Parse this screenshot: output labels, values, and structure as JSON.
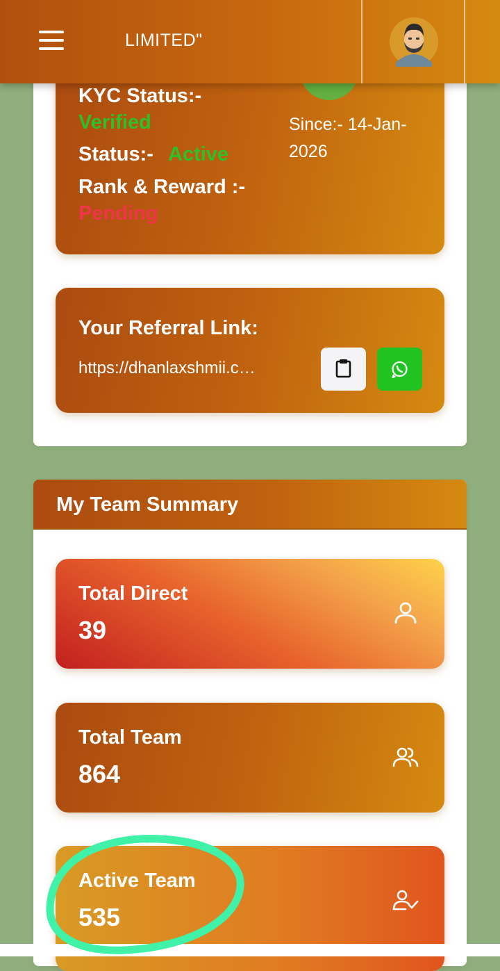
{
  "header": {
    "title": "LIMITED\"",
    "menu_icon": "hamburger-menu-icon",
    "avatar_icon": "user-avatar"
  },
  "profile": {
    "kyc_label": "KYC Status:-",
    "kyc_value": "Verified",
    "status_label": "Status:-",
    "status_value": "Active",
    "rank_label": "Rank & Reward :-",
    "rank_value": "Pending",
    "since_text": "Since:- 14-Jan-2026"
  },
  "referral": {
    "title": "Your Referral Link:",
    "link": "https://dhanlaxshmii.c…",
    "copy_icon": "clipboard-icon",
    "share_icon": "whatsapp-icon"
  },
  "team_summary": {
    "title": "My Team Summary",
    "cards": [
      {
        "label": "Total Direct",
        "value": "39",
        "icon": "user-icon"
      },
      {
        "label": "Total Team",
        "value": "864",
        "icon": "users-icon"
      },
      {
        "label": "Active Team",
        "value": "535",
        "icon": "user-check-icon"
      }
    ]
  },
  "colors": {
    "verified_green": "#2fbf2a",
    "pending_red": "#f0344a",
    "whatsapp_green": "#21c322",
    "page_bg": "#8fb07c",
    "highlight_circle": "#3ff2a8"
  }
}
